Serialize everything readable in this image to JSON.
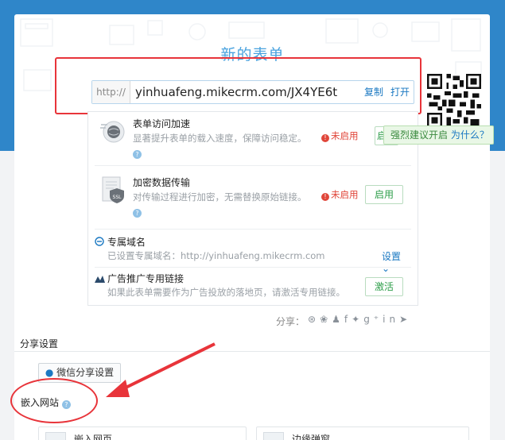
{
  "form": {
    "title": "新的表单",
    "url_prefix": "http://",
    "url": "yinhuafeng.mikecrm.com/JX4YE6t",
    "copy_label": "复制",
    "open_label": "打开"
  },
  "tooltip": {
    "text": "强烈建议开启",
    "link": "为什么？"
  },
  "features": [
    {
      "title": "表单访问加速",
      "desc": "显著提升表单的载入速度，保障访问稳定。",
      "status": "未启用",
      "button": "启用"
    },
    {
      "title": "加密数据传输",
      "desc": "对传输过程进行加密，无需替换原始链接。",
      "status": "未启用",
      "button": "启用"
    }
  ],
  "domain": {
    "title": "专属域名",
    "desc": "已设置专属域名：http://yinhuafeng.mikecrm.com",
    "button": "设置"
  },
  "ad_link": {
    "title": "广告推广专用链接",
    "desc": "如果此表单需要作为广告投放的落地页，请激活专用链接。",
    "button": "激活"
  },
  "share": {
    "label": "分享："
  },
  "share_settings": {
    "title": "分享设置",
    "wechat_button": "微信分享设置"
  },
  "embed": {
    "title": "嵌入网站",
    "options": [
      {
        "label": "嵌入网页"
      },
      {
        "label": "边缘弹窗"
      }
    ]
  },
  "colors": {
    "header_blue": "#2f86c9",
    "accent_blue": "#1a78c2",
    "enable_green": "#2e9e4a",
    "status_red": "#e0463a",
    "annotation_red": "#e8343a"
  }
}
